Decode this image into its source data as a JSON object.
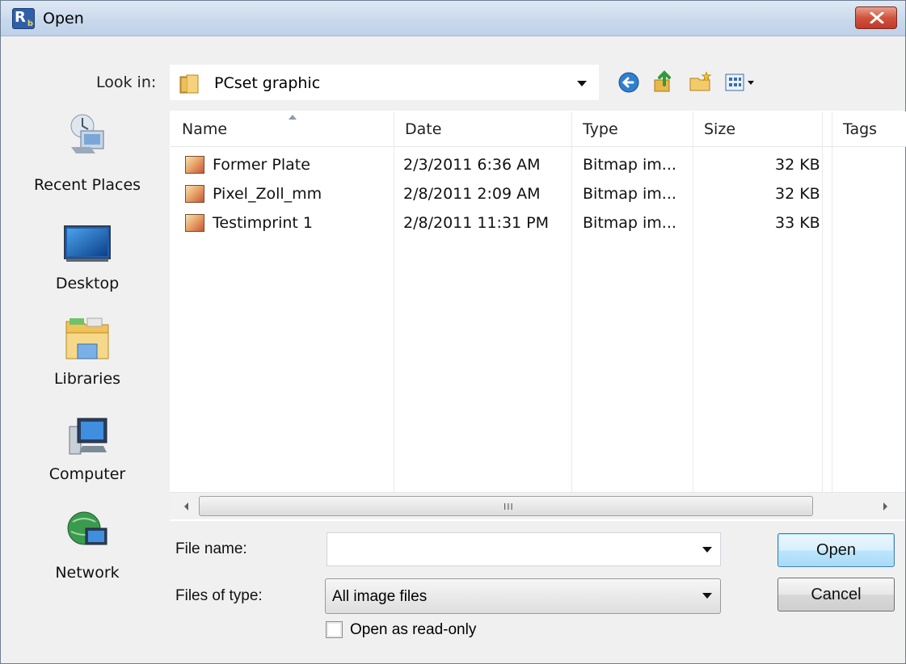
{
  "window": {
    "title": "Open",
    "close_label": "x"
  },
  "look_in": {
    "label": "Look in:",
    "value": "PCset graphic"
  },
  "toolbar": {
    "icons": [
      "back-icon",
      "up-folder-icon",
      "new-folder-icon",
      "view-menu-icon"
    ]
  },
  "places": [
    {
      "label": "Recent Places",
      "icon": "recent-places-icon"
    },
    {
      "label": "Desktop",
      "icon": "desktop-icon"
    },
    {
      "label": "Libraries",
      "icon": "libraries-icon"
    },
    {
      "label": "Computer",
      "icon": "computer-icon"
    },
    {
      "label": "Network",
      "icon": "network-icon"
    }
  ],
  "file_list": {
    "columns": [
      "Name",
      "Date",
      "Type",
      "Size",
      "Tags"
    ],
    "rows": [
      {
        "name": "Former Plate",
        "date": "2/3/2011 6:36 AM",
        "type": "Bitmap im...",
        "size": "32 KB"
      },
      {
        "name": "Pixel_Zoll_mm",
        "date": "2/8/2011 2:09 AM",
        "type": "Bitmap im...",
        "size": "32 KB"
      },
      {
        "name": "Testimprint 1",
        "date": "2/8/2011 11:31 PM",
        "type": "Bitmap im...",
        "size": "33 KB"
      }
    ],
    "scroll_grip": "III"
  },
  "form": {
    "file_name_label": "File name:",
    "file_name_value": "",
    "files_of_type_label": "Files of type:",
    "files_of_type_value": "All image files",
    "read_only_label": "Open as read-only",
    "read_only_checked": false
  },
  "buttons": {
    "open": "Open",
    "cancel": "Cancel"
  }
}
